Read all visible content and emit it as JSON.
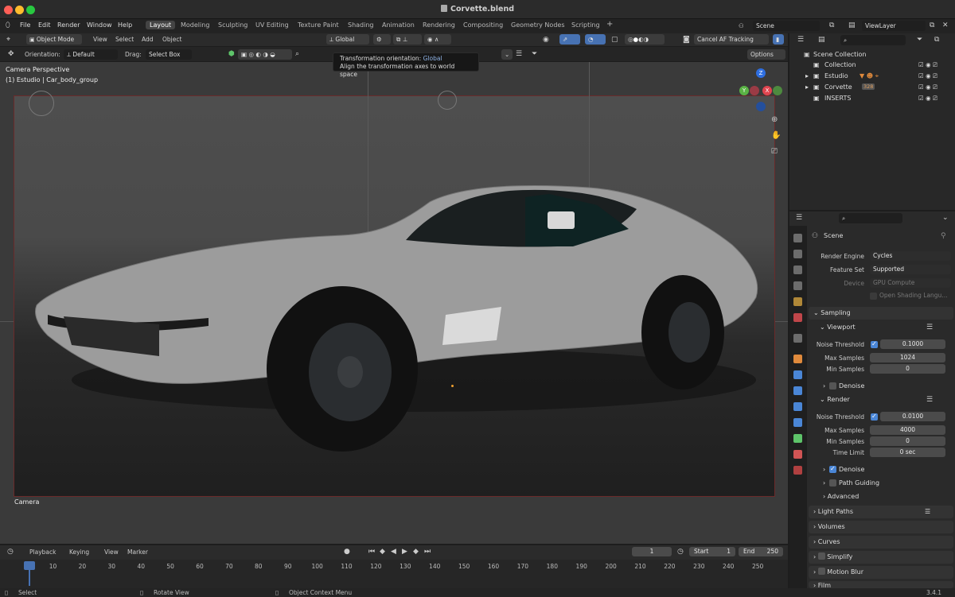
{
  "window": {
    "title": "Corvette.blend"
  },
  "menu": [
    "File",
    "Edit",
    "Render",
    "Window",
    "Help"
  ],
  "workspaces": [
    "Layout",
    "Modeling",
    "Sculpting",
    "UV Editing",
    "Texture Paint",
    "Shading",
    "Animation",
    "Rendering",
    "Compositing",
    "Geometry Nodes",
    "Scripting"
  ],
  "workspace_add": "+",
  "scene": {
    "name": "Scene",
    "view_layer": "ViewLayer"
  },
  "header": {
    "mode": "Object Mode",
    "view": "View",
    "select": "Select",
    "add": "Add",
    "object": "Object",
    "transform": "Global",
    "cancel_af": "Cancel AF Tracking",
    "orientation_label": "Orientation:",
    "orientation_value": "Default",
    "drag_label": "Drag:",
    "drag_value": "Select Box",
    "options": "Options"
  },
  "tooltip": {
    "title_prefix": "Transformation orientation:",
    "title_value": "Global",
    "desc": "Align the transformation axes to world space"
  },
  "viewport": {
    "view_name": "Camera Perspective",
    "collection": "(1) Estudio | Car_body_group",
    "camera_label": "Camera"
  },
  "outliner": {
    "root": "Scene Collection",
    "items": [
      {
        "name": "Collection",
        "badge": ""
      },
      {
        "name": "Estudio",
        "badge": ""
      },
      {
        "name": "Corvette",
        "badge": "328"
      },
      {
        "name": "INSERTS",
        "badge": ""
      }
    ]
  },
  "properties": {
    "context": "Scene",
    "render_engine_label": "Render Engine",
    "render_engine": "Cycles",
    "feature_set_label": "Feature Set",
    "feature_set": "Supported",
    "device_label": "Device",
    "device": "GPU Compute",
    "osl_label": "Open Shading Langu...",
    "sampling": "Sampling",
    "viewport": {
      "title": "Viewport",
      "noise_label": "Noise Threshold",
      "noise": "0.1000",
      "max_label": "Max Samples",
      "max": "1024",
      "min_label": "Min Samples",
      "min": "0",
      "denoise": "Denoise"
    },
    "render": {
      "title": "Render",
      "noise_label": "Noise Threshold",
      "noise": "0.0100",
      "max_label": "Max Samples",
      "max": "4000",
      "min_label": "Min Samples",
      "min": "0",
      "time_label": "Time Limit",
      "time": "0 sec",
      "denoise": "Denoise",
      "path_guiding": "Path Guiding",
      "advanced": "Advanced"
    },
    "sections": [
      "Light Paths",
      "Volumes",
      "Curves",
      "Simplify",
      "Motion Blur",
      "Film"
    ]
  },
  "timeline": {
    "playback": "Playback",
    "keying": "Keying",
    "view": "View",
    "marker": "Marker",
    "current_frame": "1",
    "start_label": "Start",
    "start": "1",
    "end_label": "End",
    "end": "250",
    "ticks": [
      "1",
      "10",
      "20",
      "30",
      "40",
      "50",
      "60",
      "70",
      "80",
      "90",
      "100",
      "110",
      "120",
      "130",
      "140",
      "150",
      "160",
      "170",
      "180",
      "190",
      "200",
      "210",
      "220",
      "230",
      "240",
      "250"
    ]
  },
  "status": {
    "select": "Select",
    "rotate": "Rotate View",
    "context_menu": "Object Context Menu",
    "version": "3.4.1"
  },
  "colors": {
    "accent": "#4a86d6",
    "active_frame": "#4772b3",
    "car_body": "#9c9c9c"
  }
}
